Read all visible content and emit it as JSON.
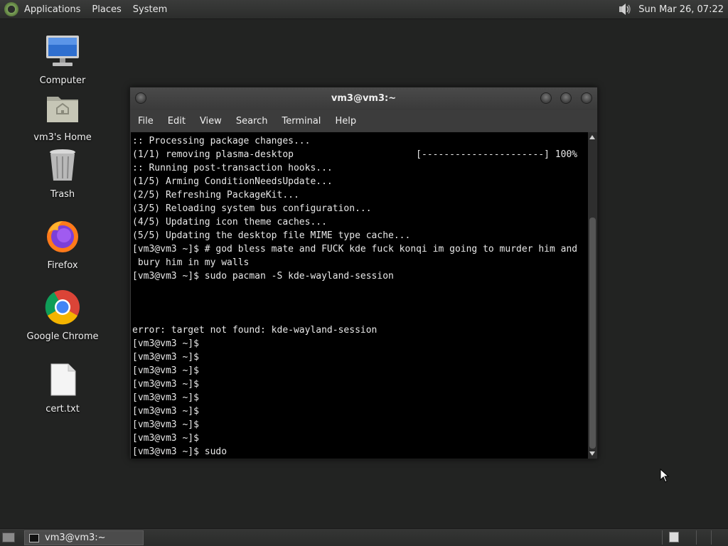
{
  "top_panel": {
    "menus": [
      "Applications",
      "Places",
      "System"
    ],
    "clock": "Sun Mar 26, 07:22",
    "volume_icon": "speaker-icon"
  },
  "desktop_icons": [
    {
      "label": "Computer",
      "icon": "computer-icon"
    },
    {
      "label": "vm3's Home",
      "icon": "home-folder-icon"
    },
    {
      "label": "Trash",
      "icon": "trash-icon"
    },
    {
      "label": "Firefox",
      "icon": "firefox-icon"
    },
    {
      "label": "Google Chrome",
      "icon": "chrome-icon"
    },
    {
      "label": "cert.txt",
      "icon": "text-file-icon"
    }
  ],
  "terminal": {
    "title": "vm3@vm3:~",
    "menu": [
      "File",
      "Edit",
      "View",
      "Search",
      "Terminal",
      "Help"
    ],
    "lines": [
      ":: Processing package changes...",
      "(1/1) removing plasma-desktop                      [----------------------] 100%",
      ":: Running post-transaction hooks...",
      "(1/5) Arming ConditionNeedsUpdate...",
      "(2/5) Refreshing PackageKit...",
      "(3/5) Reloading system bus configuration...",
      "(4/5) Updating icon theme caches...",
      "(5/5) Updating the desktop file MIME type cache...",
      "[vm3@vm3 ~]$ # god bless mate and FUCK kde fuck konqi im going to murder him and",
      " bury him in my walls",
      "[vm3@vm3 ~]$ sudo pacman -S kde-wayland-session",
      "",
      "",
      "",
      "error: target not found: kde-wayland-session",
      "[vm3@vm3 ~]$",
      "[vm3@vm3 ~]$",
      "[vm3@vm3 ~]$",
      "[vm3@vm3 ~]$",
      "[vm3@vm3 ~]$",
      "[vm3@vm3 ~]$",
      "[vm3@vm3 ~]$",
      "[vm3@vm3 ~]$",
      "[vm3@vm3 ~]$ sudo"
    ]
  },
  "taskbar": {
    "task_label": "vm3@vm3:~"
  },
  "colors": {
    "desktop_bg": "#222322",
    "terminal_bg": "#000000",
    "panel_bg": "#333433"
  }
}
